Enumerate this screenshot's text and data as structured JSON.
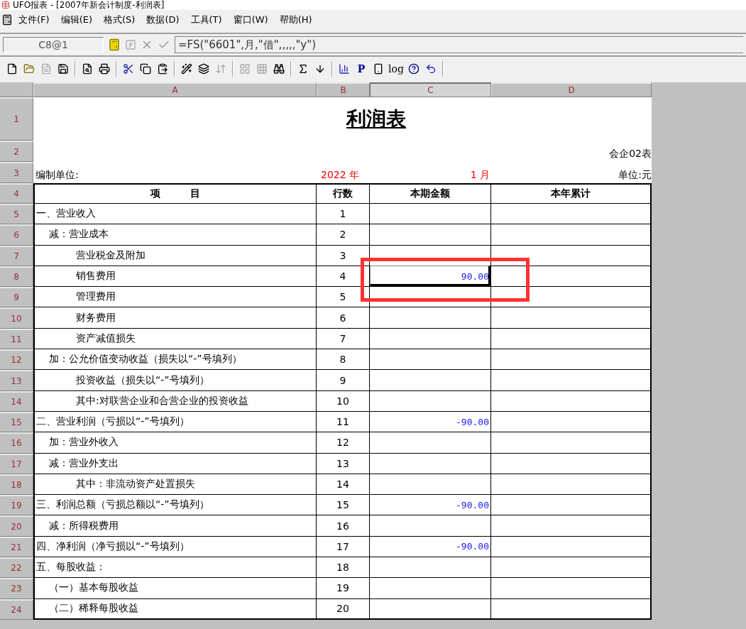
{
  "window": {
    "title": "UFO报表 - [2007年新会计制度-利润表]"
  },
  "menu": [
    "文件(F)",
    "编辑(E)",
    "格式(S)",
    "数据(D)",
    "工具(T)",
    "窗口(W)",
    "帮助(H)"
  ],
  "formula_bar": {
    "cell_ref": "C8@1",
    "formula": "=FS(\"6601\",月,\"借\",,,,,\"y\")"
  },
  "toolbar_labels": [
    "P",
    "log"
  ],
  "sheet": {
    "columns": [
      {
        "label": "A",
        "selected": false
      },
      {
        "label": "B",
        "selected": false
      },
      {
        "label": "C",
        "selected": true
      },
      {
        "label": "D",
        "selected": false
      }
    ],
    "row_numbers": [
      "1",
      "2",
      "3",
      "4",
      "5",
      "6",
      "7",
      "8",
      "9",
      "10",
      "11",
      "12",
      "13",
      "14",
      "15",
      "16",
      "17",
      "18",
      "19",
      "20",
      "21",
      "22",
      "23",
      "24"
    ],
    "title": "利润表",
    "form_code": "会企02表",
    "unit_label": "编制单位:",
    "year": "2022 年",
    "month": "1 月",
    "currency": "单位:元",
    "headers": [
      "项　　　目",
      "行数",
      "本期金额",
      "本年累计"
    ],
    "rows": [
      {
        "kind": "heading",
        "item": "一、营业收入",
        "line": "1",
        "selected": false,
        "highlighted": false
      },
      {
        "kind": "adjust",
        "item": "减：营业成本",
        "line": "2",
        "selected": false,
        "highlighted": false
      },
      {
        "kind": "detail",
        "item": "营业税金及附加",
        "line": "3",
        "selected": false,
        "highlighted": false
      },
      {
        "kind": "detail",
        "item": "销售费用",
        "line": "4",
        "current": "90.00",
        "selected": true,
        "highlighted": true
      },
      {
        "kind": "detail",
        "item": "管理费用",
        "line": "5",
        "selected": false,
        "highlighted": false
      },
      {
        "kind": "detail",
        "item": "财务费用",
        "line": "6",
        "selected": false,
        "highlighted": false
      },
      {
        "kind": "detail",
        "item": "资产减值损失",
        "line": "7",
        "selected": false,
        "highlighted": false
      },
      {
        "kind": "adjust",
        "item": "加：公允价值变动收益（损失以“-”号填列）",
        "line": "8",
        "selected": false,
        "highlighted": false
      },
      {
        "kind": "detail",
        "item": "投资收益（损失以“-”号填列）",
        "line": "9",
        "selected": false,
        "highlighted": false
      },
      {
        "kind": "detail",
        "item": "其中:对联营企业和合营企业的投资收益",
        "line": "10",
        "selected": false,
        "highlighted": false
      },
      {
        "kind": "heading",
        "item": "二、营业利润（亏损以“-”号填列）",
        "line": "11",
        "current": "-90.00",
        "selected": false,
        "highlighted": false
      },
      {
        "kind": "adjust",
        "item": "加：营业外收入",
        "line": "12",
        "selected": false,
        "highlighted": false
      },
      {
        "kind": "adjust",
        "item": "减：营业外支出",
        "line": "13",
        "selected": false,
        "highlighted": false
      },
      {
        "kind": "detail",
        "item": "其中：非流动资产处置损失",
        "line": "14",
        "selected": false,
        "highlighted": false
      },
      {
        "kind": "heading",
        "item": "三、利润总额（亏损总额以“-”号填列）",
        "line": "15",
        "current": "-90.00",
        "selected": false,
        "highlighted": false
      },
      {
        "kind": "adjust",
        "item": "减：所得税费用",
        "line": "16",
        "selected": false,
        "highlighted": false
      },
      {
        "kind": "heading",
        "item": "四、净利润（净亏损以“-”号填列）",
        "line": "17",
        "current": "-90.00",
        "selected": false,
        "highlighted": false
      },
      {
        "kind": "heading",
        "item": "五、每股收益：",
        "line": "18",
        "selected": false,
        "highlighted": false
      },
      {
        "kind": "adjust",
        "item": "（一）基本每股收益",
        "line": "19",
        "selected": false,
        "highlighted": false
      },
      {
        "kind": "adjust",
        "item": "（二）稀释每股收益",
        "line": "20",
        "selected": false,
        "highlighted": false
      }
    ]
  }
}
